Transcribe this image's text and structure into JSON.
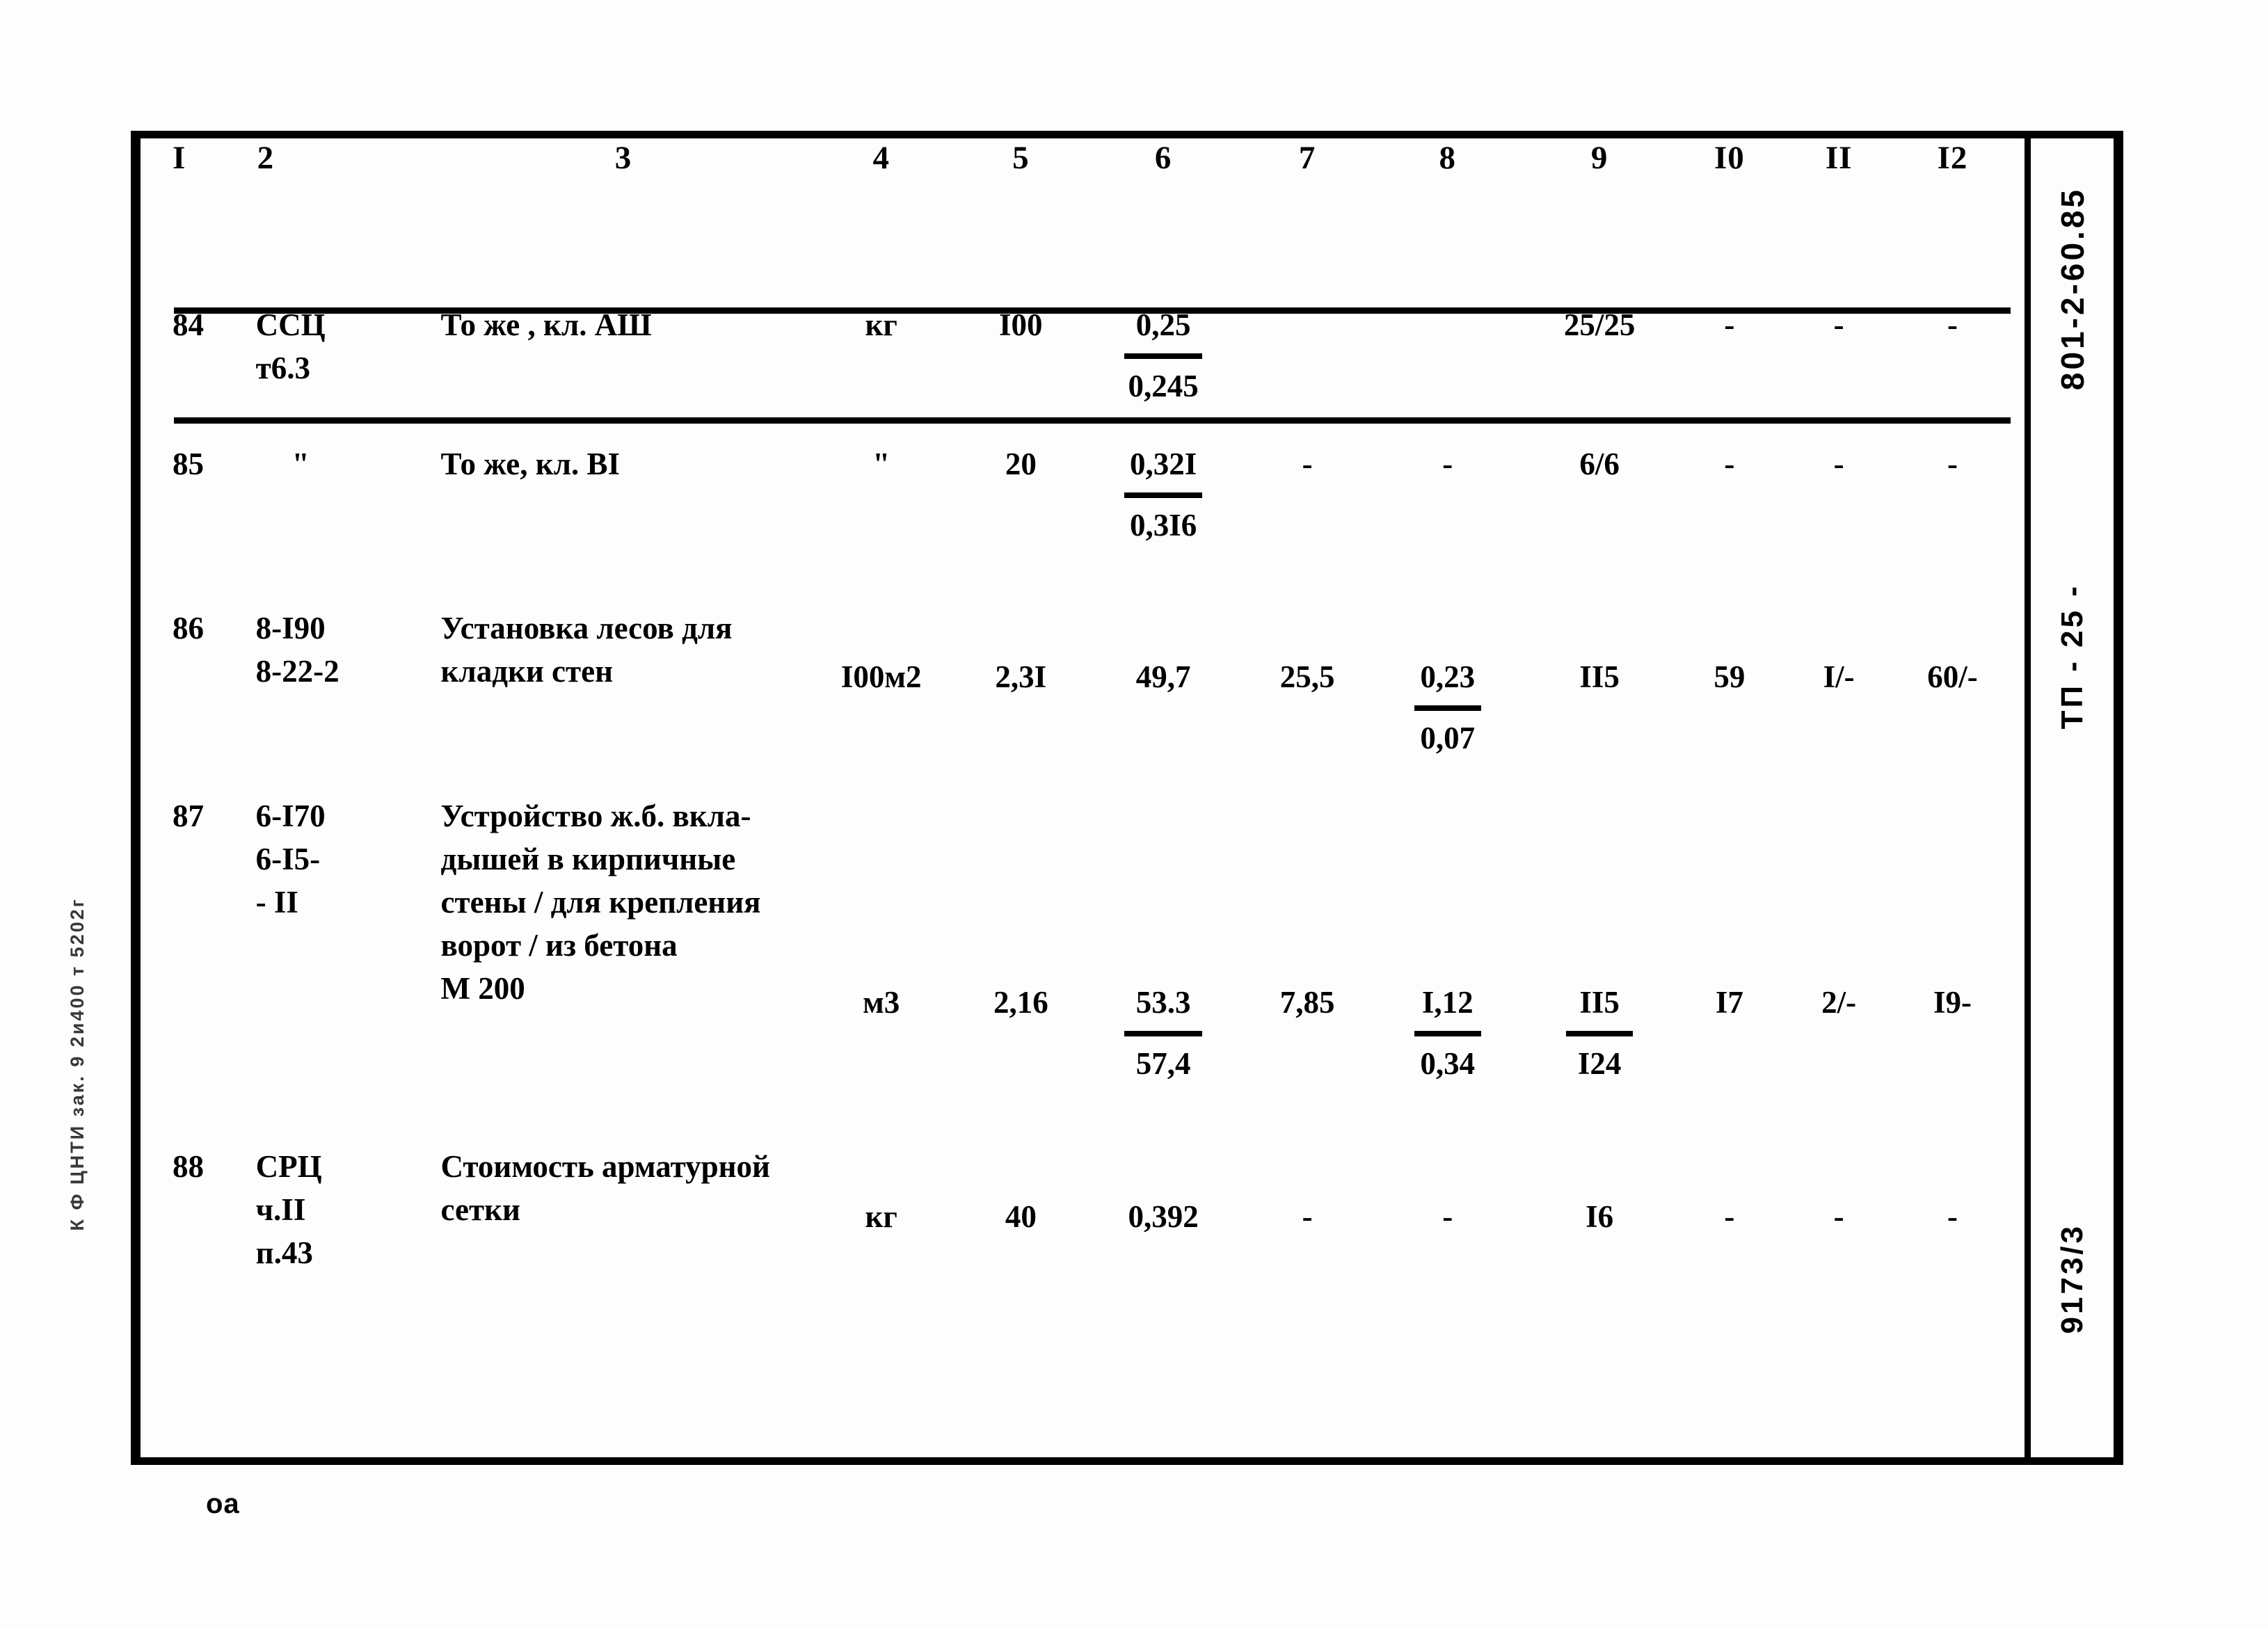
{
  "document": {
    "right_margin": {
      "code": "801-2-60.85",
      "series": "ТП  -  25  -",
      "sheet_number": "9173/3"
    },
    "left_margin_stamp": "К Ф ЦНТИ зак. 9 2и400 т 5202г",
    "bottom_mark": "оа"
  },
  "table": {
    "column_headers": [
      "I",
      "2",
      "3",
      "4",
      "5",
      "6",
      "7",
      "8",
      "9",
      "I0",
      "II",
      "I2"
    ],
    "rows": [
      {
        "no": "84",
        "code": "ССЦ\nт6.3",
        "description": "То же , кл. АШ",
        "unit": "кг",
        "qty": "I00",
        "c6_num": "0,25",
        "c6_den": "0,245",
        "c7": "",
        "c8": "",
        "c9": "25/25",
        "c10": "-",
        "c11": "-",
        "c12": "-"
      },
      {
        "no": "85",
        "code": "\"",
        "description": "То же, кл. ВI",
        "unit": "\"",
        "qty": "20",
        "c6_num": "0,32I",
        "c6_den": "0,3I6",
        "c7": "-",
        "c8": "-",
        "c9": "6/6",
        "c10": "-",
        "c11": "-",
        "c12": "-"
      },
      {
        "no": "86",
        "code": "8-I90\n8-22-2",
        "description": "Установка лесов для\nкладки стен",
        "unit": "I00м2",
        "qty": "2,3I",
        "c6": "49,7",
        "c7": "25,5",
        "c8_num": "0,23",
        "c8_den": "0,07",
        "c9": "II5",
        "c10": "59",
        "c11": "I/-",
        "c12": "60/-"
      },
      {
        "no": "87",
        "code": "6-I70\n6-I5-\n- II",
        "description": "Устройство ж.б. вкла-\nдышей в кирпичные\nстены / для крепления\nворот / из бетона\nМ 200",
        "unit": "м3",
        "qty": "2,16",
        "c6_num": "53.3",
        "c6_den": "57,4",
        "c7": "7,85",
        "c8_num": "I,12",
        "c8_den": "0,34",
        "c9_num": "II5",
        "c9_den": "I24",
        "c10": "I7",
        "c11": "2/-",
        "c12": "I9-"
      },
      {
        "no": "88",
        "code": "СРЦ\nч.II\nп.43",
        "description": "Стоимость арматурной\nсетки",
        "unit": "кг",
        "qty": "40",
        "c6": "0,392",
        "c7": "-",
        "c8": "-",
        "c9": "I6",
        "c10": "-",
        "c11": "-",
        "c12": "-"
      }
    ]
  }
}
